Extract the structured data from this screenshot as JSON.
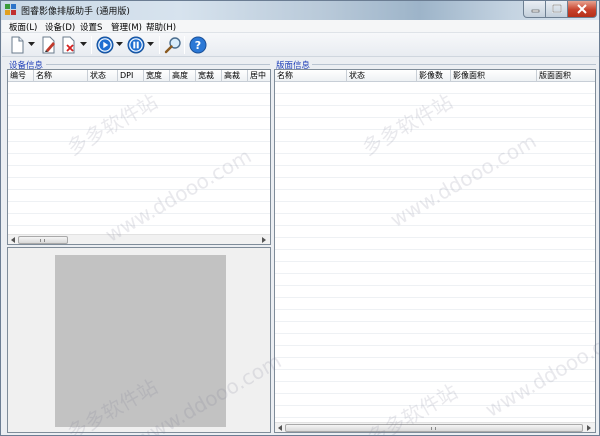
{
  "window": {
    "title": "图睿影像排版助手 (通用版)"
  },
  "menu": {
    "items": [
      "板面(L)",
      "设备(D)",
      "设置S",
      "管理(M)",
      "帮助(H)"
    ]
  },
  "toolbar": {
    "buttons": [
      "new-document",
      "edit-document",
      "delete-document",
      "play",
      "pause",
      "search",
      "help"
    ],
    "help_glyph": "?"
  },
  "device_panel": {
    "section_label": "设备信息",
    "columns": [
      "编号",
      "名称",
      "状态",
      "DPI",
      "宽度",
      "高度",
      "宽裁",
      "高裁",
      "居中"
    ]
  },
  "layout_panel": {
    "section_label": "版面信息",
    "columns": [
      "名称",
      "状态",
      "影像数",
      "影像面积",
      "版面面积"
    ]
  },
  "watermark": {
    "lines": [
      "多多软件站",
      "www.ddooo.com"
    ]
  },
  "colors": {
    "section_label": "#1f3fb8",
    "preview_fill": "#c2c2c2",
    "close_button": "#c8422c"
  }
}
